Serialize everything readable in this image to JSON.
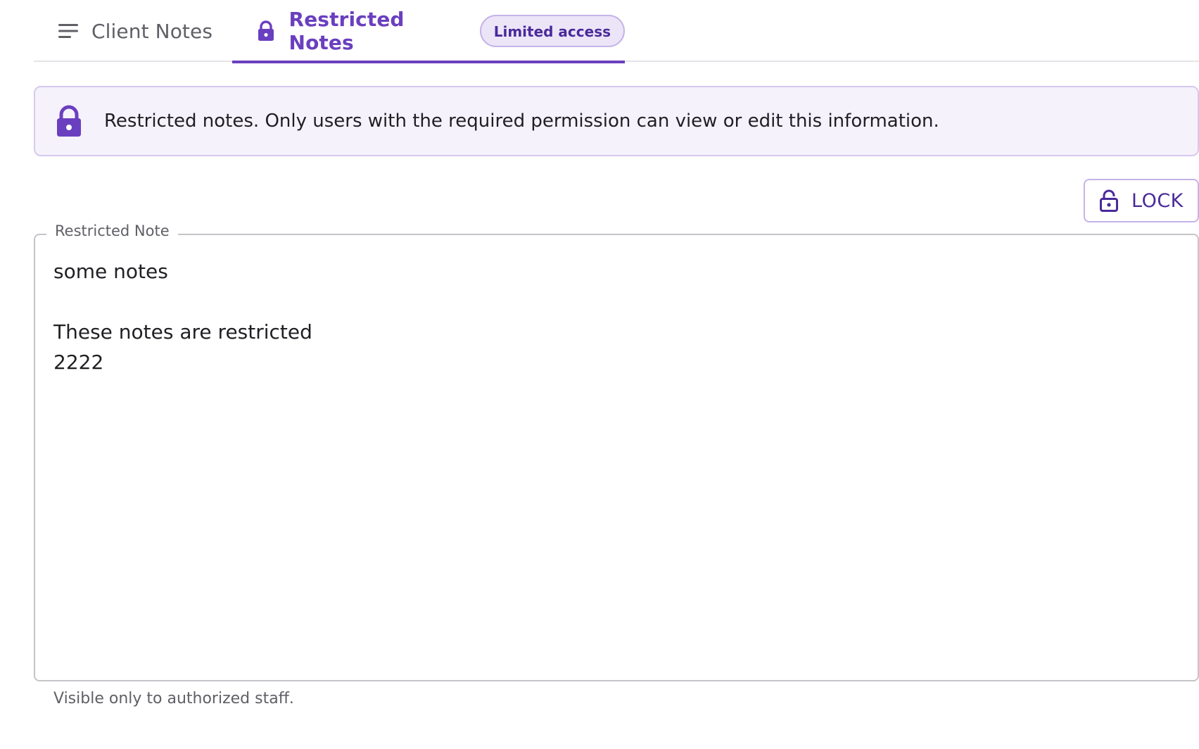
{
  "tabs": {
    "client_label": "Client Notes",
    "client_icon": "menu-lines-icon",
    "restricted_label": "Restricted Notes",
    "restricted_icon": "lock-icon",
    "restricted_badge": "Limited access"
  },
  "banner": {
    "icon": "lock-icon",
    "text": "Restricted notes. Only users with the required permission can view or edit this information."
  },
  "lock_button": {
    "icon": "unlocked-padlock-icon",
    "label": "LOCK"
  },
  "note_field": {
    "label": "Restricted Note",
    "value": "some notes\n\nThese notes are restricted\n2222",
    "helper": "Visible only to authorized staff."
  },
  "colors": {
    "accent": "#6a3fbf",
    "accent_dark": "#4a2a9a",
    "banner_bg": "#f5f2fb",
    "badge_bg": "#ece5f8"
  }
}
